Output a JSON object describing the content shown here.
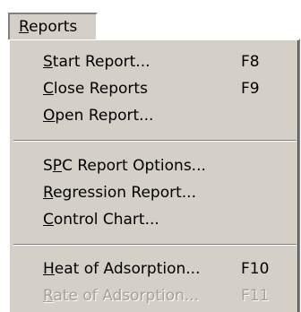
{
  "menubar": {
    "reports": {
      "prefix": "",
      "mnemonic": "R",
      "rest": "eports"
    }
  },
  "menu": {
    "items": [
      {
        "prefix": "",
        "mnemonic": "S",
        "rest": "tart Report...",
        "shortcut": "F8"
      },
      {
        "prefix": "",
        "mnemonic": "C",
        "rest": "lose Reports",
        "shortcut": "F9"
      },
      {
        "prefix": "",
        "mnemonic": "O",
        "rest": "pen Report...",
        "shortcut": ""
      },
      {
        "prefix": "S",
        "mnemonic": "P",
        "rest": "C Report Options...",
        "shortcut": ""
      },
      {
        "prefix": "",
        "mnemonic": "R",
        "rest": "egression Report...",
        "shortcut": ""
      },
      {
        "prefix": "",
        "mnemonic": "C",
        "rest": "ontrol Chart...",
        "shortcut": ""
      },
      {
        "prefix": "",
        "mnemonic": "H",
        "rest": "eat of Adsorption...",
        "shortcut": "F10"
      },
      {
        "prefix": "",
        "mnemonic": "R",
        "rest": "ate of Adsorption...",
        "shortcut": "F11"
      }
    ]
  }
}
